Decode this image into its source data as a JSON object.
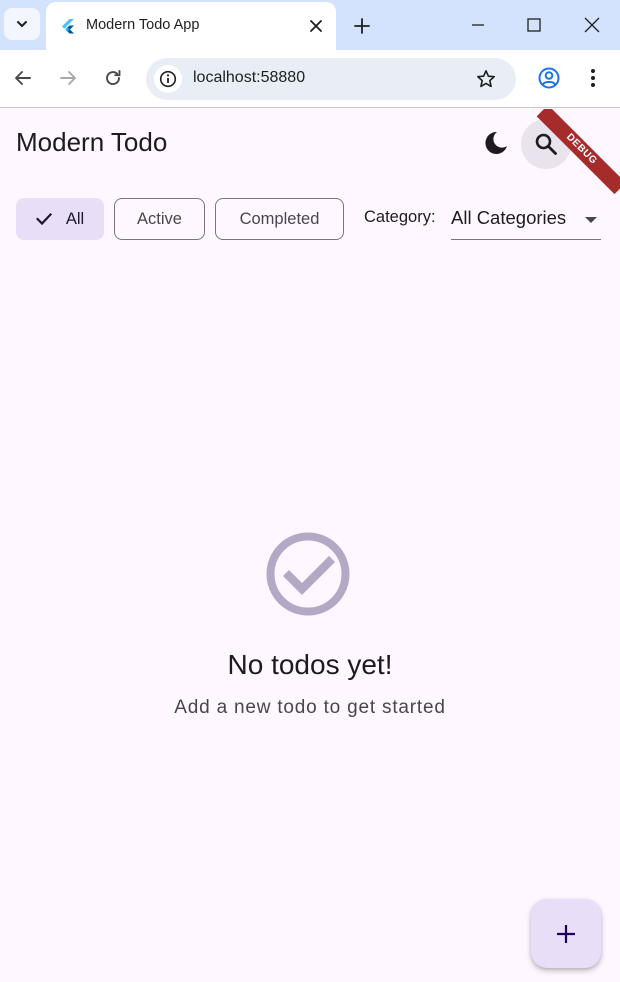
{
  "browser": {
    "tab_title": "Modern Todo App",
    "url": "localhost:58880"
  },
  "app": {
    "title": "Modern Todo",
    "debug_banner": "DEBUG",
    "filters": [
      {
        "label": "All",
        "selected": true
      },
      {
        "label": "Active",
        "selected": false
      },
      {
        "label": "Completed",
        "selected": false
      }
    ],
    "category_label": "Category:",
    "category_value": "All Categories",
    "empty_state": {
      "title": "No todos yet!",
      "subtitle": "Add a new todo to get started"
    }
  },
  "colors": {
    "background": "#fef7ff",
    "accent_container": "#e8def8",
    "empty_icon": "#b3a9c4",
    "debug_ribbon": "#a62b2b",
    "profile_icon": "#1a73e8"
  },
  "icons": {
    "tab_search": "chevron-down-icon",
    "favicon": "flutter-logo-icon",
    "tab_close": "close-icon",
    "new_tab": "plus-icon",
    "back": "arrow-left-icon",
    "forward": "arrow-right-icon",
    "reload": "reload-icon",
    "site_info": "info-icon",
    "bookmark": "star-icon",
    "profile": "account-circle-icon",
    "menu": "more-vert-icon",
    "theme": "moon-icon",
    "search": "search-icon",
    "empty_state": "check-circle-icon",
    "fab": "add-icon"
  }
}
